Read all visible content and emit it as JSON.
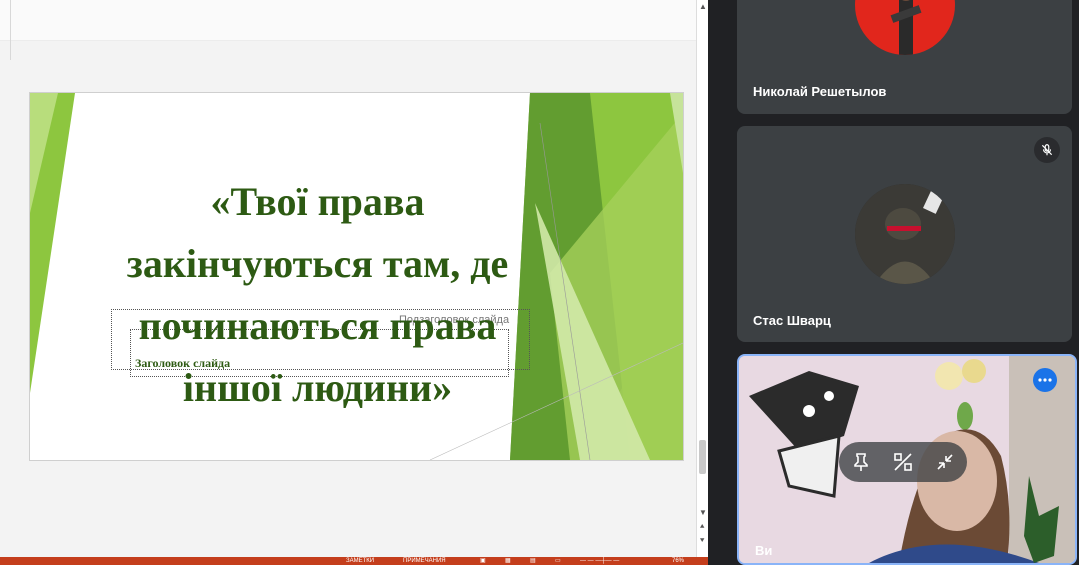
{
  "slide": {
    "title": "«Твої права\nзакінчуються там, де\nпочинаються права\nіншої людини»",
    "subtitle_placeholder": "Подзаголовок слайда",
    "title_placeholder": "Заголовок слайда"
  },
  "statusbar": {
    "notes": "ЗАМЕТКИ",
    "comments": "ПРИМЕЧАНИЯ",
    "zoom": "76%"
  },
  "participants": [
    {
      "name": "Николай Решетылов"
    },
    {
      "name": "Стас Шварц"
    },
    {
      "name": "Ви"
    }
  ],
  "colors": {
    "title_green": "#2d5a13",
    "accent_green": "#8dc63f",
    "tile_bg": "#3c4043",
    "active_border": "#8ab4f8",
    "statusbar": "#c43e1c"
  },
  "icons": [
    "pin-icon",
    "remove-icon",
    "minimize-icon",
    "more-options-icon",
    "mic-off-icon"
  ]
}
